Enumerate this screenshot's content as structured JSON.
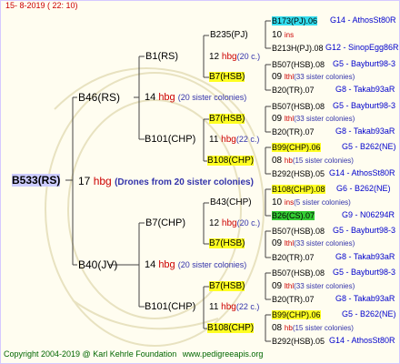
{
  "header": {
    "date": "15- 8-2019 ( 22: 10)"
  },
  "root": {
    "label": "B533(RS)"
  },
  "root_link": {
    "count": "17",
    "unit": "hbg",
    "note": "(Drones from 20 sister colonies)"
  },
  "gen1": [
    {
      "label": "B46(RS)",
      "count": "14",
      "unit": "hbg",
      "note": "(20 sister colonies)"
    },
    {
      "label": "B40(JV)",
      "count": "14",
      "unit": "hbg",
      "note": "(20 sister colonies)"
    }
  ],
  "gen2": [
    {
      "label": "B1(RS)",
      "count": "12",
      "unit": "hbg",
      "note": "(20 c.)"
    },
    {
      "label": "B101(CHP)",
      "count": "11",
      "unit": "hbg",
      "note": "(22 c.)"
    },
    {
      "label": "B7(CHP)",
      "count": "12",
      "unit": "hbg",
      "note": "(20 c.)"
    },
    {
      "label": "B101(CHP)",
      "count": "11",
      "unit": "hbg",
      "note": "(22 c.)"
    }
  ],
  "gen3": [
    {
      "label": "B235(PJ)",
      "count": "10",
      "unit": "ins",
      "note": ""
    },
    {
      "label": "B7(HSB)",
      "count": "09",
      "unit": "lthl",
      "note": "(33 sister colonies)"
    },
    {
      "label": "B7(HSB)",
      "count": "09",
      "unit": "lthl",
      "note": "(33 sister colonies)"
    },
    {
      "label": "B108(CHP)",
      "count": "08",
      "unit": "hb",
      "note": "(15 sister colonies)"
    },
    {
      "label": "B43(CHP)",
      "count": "10",
      "unit": "ins",
      "note": "(5 sister colonies)"
    },
    {
      "label": "B7(HSB)",
      "count": "09",
      "unit": "lthl",
      "note": "(33 sister colonies)"
    },
    {
      "label": "B7(HSB)",
      "count": "09",
      "unit": "lthl",
      "note": "(33 sister colonies)"
    },
    {
      "label": "B108(CHP)",
      "count": "08",
      "unit": "hb",
      "note": "(15 sister colonies)"
    }
  ],
  "gen4": [
    {
      "label": "B173(PJ).06",
      "ped": "G14 - AthosSt80R"
    },
    {
      "label": "B213H(PJ).08",
      "ped": "G12 - SinopEgg86R"
    },
    {
      "label": "B507(HSB).08",
      "ped": "G5 - Bayburt98-3"
    },
    {
      "label": "B20(TR).07",
      "ped": "G8 - Takab93aR"
    },
    {
      "label": "B507(HSB).08",
      "ped": "G5 - Bayburt98-3"
    },
    {
      "label": "B20(TR).07",
      "ped": "G8 - Takab93aR"
    },
    {
      "label": "B99(CHP).06",
      "ped": "G5 - B262(NE)"
    },
    {
      "label": "B292(HSB).05",
      "ped": "G14 - AthosSt80R"
    },
    {
      "label": "B108(CHP).08",
      "ped": "G6 - B262(NE)"
    },
    {
      "label": "B26(CS).07",
      "ped": "G9 - N06294R"
    },
    {
      "label": "B507(HSB).08",
      "ped": "G5 - Bayburt98-3"
    },
    {
      "label": "B20(TR).07",
      "ped": "G8 - Takab93aR"
    },
    {
      "label": "B507(HSB).08",
      "ped": "G5 - Bayburt98-3"
    },
    {
      "label": "B20(TR).07",
      "ped": "G8 - Takab93aR"
    },
    {
      "label": "B99(CHP).06",
      "ped": "G5 - B262(NE)"
    },
    {
      "label": "B292(HSB).05",
      "ped": "G14 - AthosSt80R"
    }
  ],
  "footer": {
    "copyright": "Copyright 2004-2019 @ Karl Kehrle Foundation",
    "url": "www.pedigreeapis.org"
  },
  "colors": {
    "yellow": "#ffff22",
    "cyan": "#33ddee",
    "green": "#33cc33",
    "hbg": "#cc0000",
    "note": "#3333aa",
    "ped": "#0000cc",
    "footer": "#006600"
  }
}
